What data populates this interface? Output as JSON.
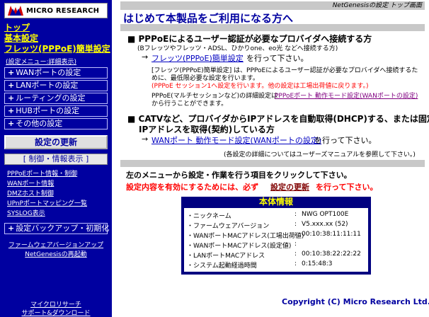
{
  "sidebar": {
    "logo_text": "MICRO RESEARCH",
    "top_link": "トップ",
    "basic_settings": "基本設定",
    "flets_easy": "フレッツ(PPPoE)簡単設定",
    "menu_note": "(設定メニュー:詳細表示)",
    "menu_items": [
      {
        "label": "WANポートの設定"
      },
      {
        "label": "LANポートの設定"
      },
      {
        "label": "ルーティングの設定"
      },
      {
        "label": "HUBポートの設定"
      },
      {
        "label": "その他の設定"
      }
    ],
    "update_button": "設定の更新",
    "control_header": "[ 制御・情報表示 ]",
    "control_links": [
      {
        "label": "PPPoEポート情報・制御"
      },
      {
        "label": "WANポート情報"
      },
      {
        "label": "DMZホスト制御"
      },
      {
        "label": "UPnPポートマッピング一覧"
      },
      {
        "label": "SYSLOG表示"
      }
    ],
    "backup_button": "設定バックアップ・初期化",
    "firmware_link": "ファームウェアバージョンアップ",
    "restart_link": "NetGenesisの再起動",
    "bottom_links": [
      {
        "label": "マイクロリサーチ"
      },
      {
        "label": "サポート&ダウンロード"
      }
    ]
  },
  "header": {
    "breadcrumb": "NetGenesisの設定 トップ画面",
    "title": "はじめて本製品をご利用になる方へ"
  },
  "section1": {
    "heading": "■ PPPoEによるユーザー認証が必要なプロバイダへ接続する方",
    "sub": "(Bフレッツやフレッツ・ADSL、ひかりone、eo光 などへ接続する方)",
    "arrow": "→",
    "link": "フレッツ(PPPoE)簡単設定",
    "after_link": "を行って下さい。",
    "note1": "[フレッツ(PPPoE)簡単設定] は、PPPoEによるユーザー認証が必要なプロバイダへ接続するた",
    "note2": "めに、最低限必要な設定を行います。",
    "note_red": "(PPPoE セッション1へ設定を行います。他の設定は工場出荷値に戻ります。)",
    "detail_pre": "PPPoE(マルチセッションなど)の詳細設定は",
    "detail_link": "PPPoEポート 動作モード設定(WANポートの設定)",
    "detail_post": "から行うことができます。"
  },
  "section2": {
    "heading1": "■ CATVなど、プロバイダからIPアドレスを自動取得(DHCP)する、または固定",
    "heading2": "IPアドレスを取得(契約)している方",
    "arrow": "→",
    "link": "WANポート 動作モード設定(WANポートの設定)",
    "after_link": "を行って下さい。",
    "manual_note": "(各設定の詳細についてはユーザーズマニュアルを参照して下さい。)"
  },
  "instructions": {
    "line1": "左のメニューから設定・作業を行う項目をクリックして下さい。",
    "line2_pre": "設定内容を有効にするためには、必ず",
    "line2_link": "設定の更新",
    "line2_post": "を行って下さい。"
  },
  "info": {
    "title": "本体情報",
    "rows": [
      {
        "key": "・ニックネーム",
        "value": "NWG OPT100E"
      },
      {
        "key": "・ファームウェアバージョン",
        "value": "V5.xxx.xx (52)"
      },
      {
        "key": "・WANポートMACアドレス(工場出荷値)",
        "value": "00:10:38:11:11:11"
      },
      {
        "key": "・WANポートMACアドレス(設定値)",
        "value": ""
      },
      {
        "key": "・LANポートMACアドレス",
        "value": "00:10:38:22:22:22"
      },
      {
        "key": "・システム起動経過時間",
        "value": "0:15:48:3"
      }
    ]
  },
  "footer": {
    "copyright": "Copyright (C) Micro Research Ltd."
  }
}
